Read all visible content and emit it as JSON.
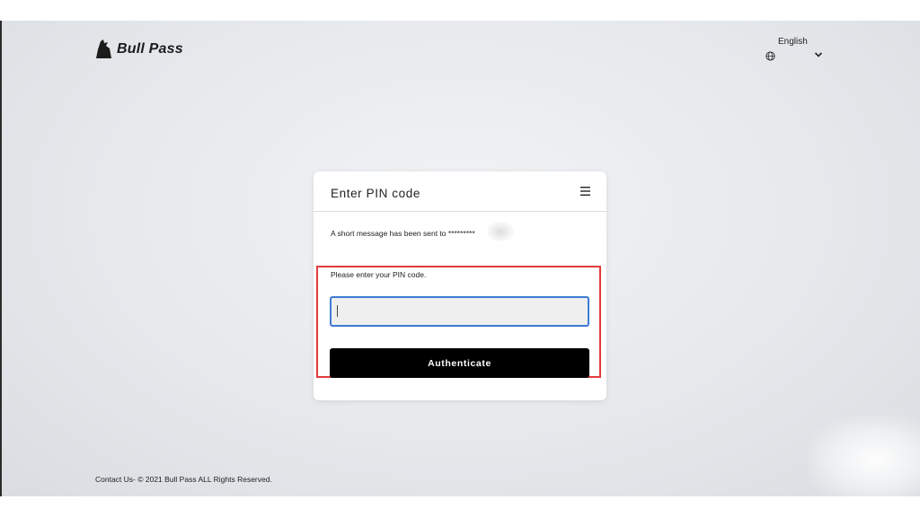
{
  "brand": {
    "name": "Bull Pass"
  },
  "language": {
    "selected": "English"
  },
  "card": {
    "title": "Enter PIN code",
    "message": "A short message has been sent to *********",
    "prompt": "Please enter your PIN code.",
    "pin_value": "",
    "button_label": "Authenticate"
  },
  "footer": {
    "text": "Contact Us- © 2021 Bull Pass ALL Rights Reserved."
  },
  "colors": {
    "highlight": "#e23b3b",
    "input_focus": "#3e7bd4",
    "button": "#000000"
  },
  "icons": [
    "bull-logo-icon",
    "globe-icon",
    "chevron-down-icon",
    "menu-icon"
  ]
}
